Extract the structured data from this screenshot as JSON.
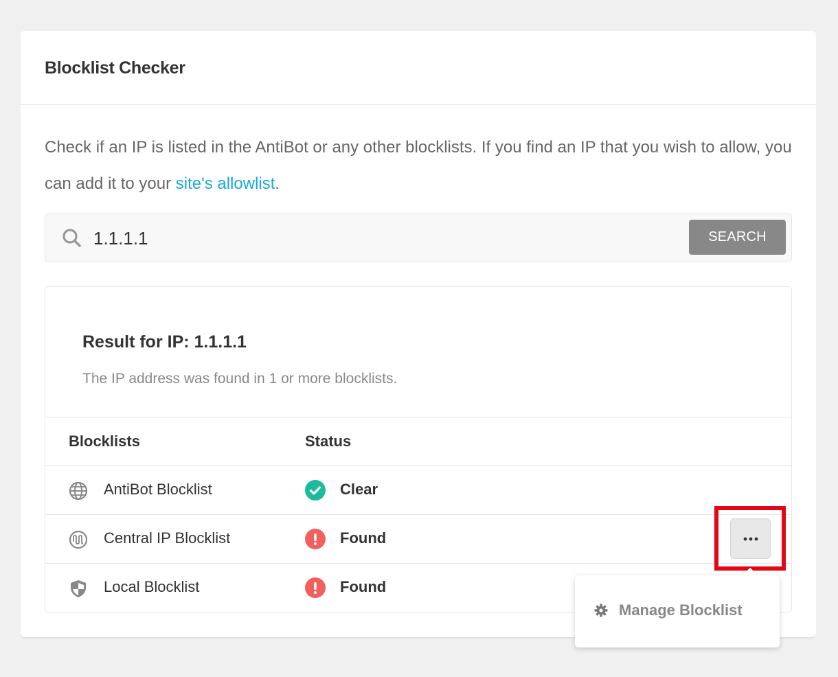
{
  "card": {
    "title": "Blocklist Checker",
    "description_prefix": "Check if an IP is listed in the AntiBot or any other blocklists. If you find an IP that you wish to allow, you can add it to your ",
    "description_link": "site's allowlist",
    "description_suffix": "."
  },
  "search": {
    "icon": "search-icon",
    "value": "1.1.1.1",
    "button_label": "SEARCH"
  },
  "result": {
    "title": "Result for IP: 1.1.1.1",
    "subtitle": "The IP address was found in 1 or more blocklists.",
    "columns": [
      "Blocklists",
      "Status"
    ],
    "rows": [
      {
        "name": "AntiBot Blocklist",
        "icon": "globe-icon",
        "status": "Clear",
        "status_icon": "check-circle-icon",
        "status_color": "#1abc9c"
      },
      {
        "name": "Central IP Blocklist",
        "icon": "wave-circle-icon",
        "status": "Found",
        "status_icon": "exclamation-circle-icon",
        "status_color": "#f0605d"
      },
      {
        "name": "Local Blocklist",
        "icon": "shield-icon",
        "status": "Found",
        "status_icon": "exclamation-circle-icon",
        "status_color": "#f0605d"
      }
    ]
  },
  "dropdown": {
    "item_label": "Manage Blocklist",
    "item_icon": "gear-icon"
  },
  "colors": {
    "link": "#17a8e3",
    "highlight": "#e30613",
    "button": "#888888"
  }
}
